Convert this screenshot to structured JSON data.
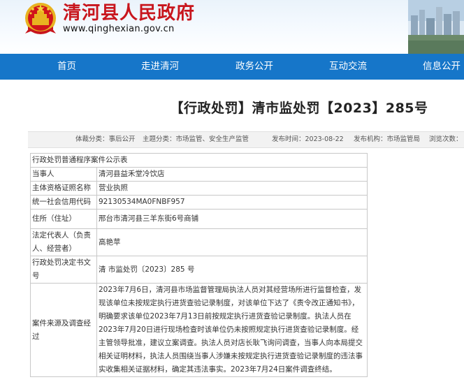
{
  "header": {
    "site_name": "清河县人民政府",
    "site_url": "www.qinghexian.gov.cn"
  },
  "nav": {
    "items": [
      {
        "label": "首页"
      },
      {
        "label": "走进清河"
      },
      {
        "label": "政务公开"
      },
      {
        "label": "互动交流"
      },
      {
        "label": "信息公开"
      }
    ]
  },
  "document": {
    "title": "【行政处罚】清市监处罚【2023】285号"
  },
  "meta": {
    "category": "体裁分类：事后公开",
    "topic": "主题分类：市场监管、安全生产监管",
    "date": "发布时间：2023-08-22",
    "publisher": "发布机构：市场监管局",
    "views": "浏览次数："
  },
  "table": {
    "caption": "行政处罚普通程序案件公示表",
    "rows": [
      {
        "label": "当事人",
        "value": "清河县益禾堂冷饮店"
      },
      {
        "label": "主体资格证照名称",
        "value": "营业执照"
      },
      {
        "label": "统一社会信用代码",
        "value": "92130534MA0FNBF957"
      },
      {
        "label": "住所（住址）",
        "value": "邢台市清河县三羊东街6号商铺"
      },
      {
        "label": "法定代表人（负责人、经营者）",
        "value": "高艳苹"
      },
      {
        "label": "行政处罚决定书文号",
        "value": " 清 市监处罚〔2023〕285 号"
      }
    ],
    "narrative": {
      "label": "案件来源及调查经过",
      "value": "2023年7月6日，清河县市场监督管理局执法人员对其经营场所进行监督检查，发现该单位未按规定执行进货查验记录制度，对该单位下达了《责令改正通知书》，明确要求该单位2023年7月13日前按规定执行进货查验记录制度。执法人员在2023年7月20日进行现场检查时该单位仍未按照规定执行进货查验记录制度。经主管领导批准，建议立案调查。执法人员对店长耿飞询问调查，当事人向本局提交相关证明材料，执法人员围绕当事人涉嫌未按规定执行进货查验记录制度的违法事实收集相关证据材料，确定其违法事实。2023年7月24日案件调查终结。"
    }
  }
}
